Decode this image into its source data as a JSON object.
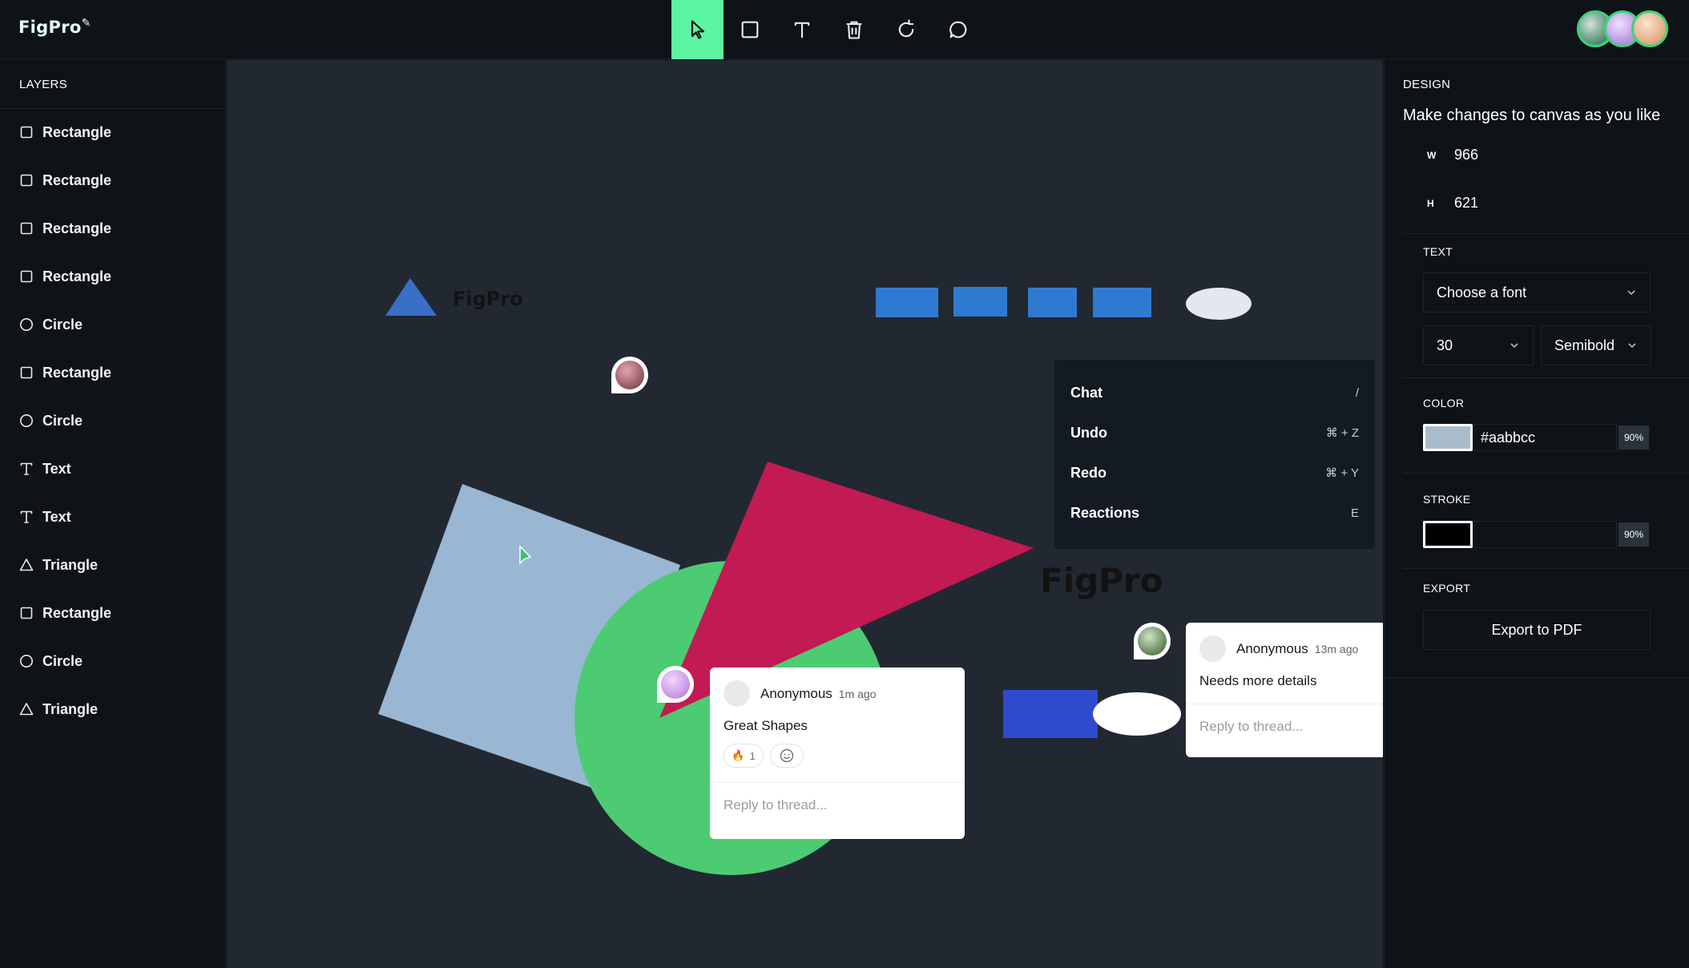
{
  "app": {
    "logo_text": "FigPro"
  },
  "toolbar": {
    "tools": [
      {
        "name": "select",
        "icon": "cursor-arrow-icon",
        "active": true
      },
      {
        "name": "rectangle",
        "icon": "square-icon"
      },
      {
        "name": "text",
        "icon": "text-t-icon"
      },
      {
        "name": "delete",
        "icon": "trash-icon"
      },
      {
        "name": "reset",
        "icon": "rotate-icon"
      },
      {
        "name": "comments",
        "icon": "chat-bubble-icon"
      }
    ],
    "active_color": "#5cf5a2"
  },
  "layers": {
    "title": "LAYERS",
    "items": [
      {
        "label": "Rectangle",
        "icon": "square-icon"
      },
      {
        "label": "Rectangle",
        "icon": "square-icon"
      },
      {
        "label": "Rectangle",
        "icon": "square-icon"
      },
      {
        "label": "Rectangle",
        "icon": "square-icon"
      },
      {
        "label": "Circle",
        "icon": "circle-icon"
      },
      {
        "label": "Rectangle",
        "icon": "square-icon"
      },
      {
        "label": "Circle",
        "icon": "circle-icon"
      },
      {
        "label": "Text",
        "icon": "text-t-icon"
      },
      {
        "label": "Text",
        "icon": "text-t-icon"
      },
      {
        "label": "Triangle",
        "icon": "triangle-icon"
      },
      {
        "label": "Rectangle",
        "icon": "square-icon"
      },
      {
        "label": "Circle",
        "icon": "circle-icon"
      },
      {
        "label": "Triangle",
        "icon": "triangle-icon"
      }
    ]
  },
  "canvas": {
    "texts": [
      "FigPro",
      "FigPro"
    ],
    "shape_colors": {
      "tilted_rect": "#99b6d3",
      "circle": "#4ccb73",
      "triangle": "#c21a52",
      "small_triangle": "#3a6fc7",
      "blue_rects": "#2f7ad0",
      "dark_blue_rect": "#2e4bd0",
      "ellipses": "#e4e8ee"
    }
  },
  "comments": [
    {
      "author": "Anonymous",
      "time": "1m ago",
      "body": "Great Shapes",
      "reaction_emoji": "🔥",
      "reaction_count": "1",
      "reply_placeholder": "Reply to thread..."
    },
    {
      "author": "Anonymous",
      "time": "13m ago",
      "body": "Needs more details",
      "reply_placeholder": "Reply to thread..."
    }
  ],
  "context_menu": {
    "items": [
      {
        "label": "Chat",
        "shortcut": "/"
      },
      {
        "label": "Undo",
        "shortcut": "⌘ + Z"
      },
      {
        "label": "Redo",
        "shortcut": "⌘ + Y"
      },
      {
        "label": "Reactions",
        "shortcut": "E"
      }
    ]
  },
  "design": {
    "title": "DESIGN",
    "subtitle": "Make changes to canvas as you like",
    "width_label": "W",
    "width_value": "966",
    "height_label": "H",
    "height_value": "621",
    "text_section": "TEXT",
    "font_family": "Choose a font",
    "font_size": "30",
    "font_weight": "Semibold",
    "color_section": "COLOR",
    "color_hex": "#aabbcc",
    "color_opacity": "90%",
    "stroke_section": "STROKE",
    "stroke_color": "#000000",
    "stroke_opacity": "90%",
    "export_section": "EXPORT",
    "export_button": "Export to PDF"
  }
}
